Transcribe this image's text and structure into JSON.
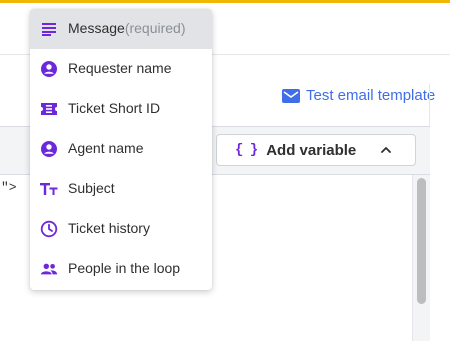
{
  "header": {
    "test_email_label": "Test email template"
  },
  "editor": {
    "code_snippet": "\">",
    "add_variable_label": "Add variable"
  },
  "variable_menu": {
    "items": [
      {
        "label": "Message",
        "hint": "(required)",
        "icon": "text-lines-icon"
      },
      {
        "label": "Requester name",
        "hint": "",
        "icon": "person-circle-icon"
      },
      {
        "label": "Ticket Short ID",
        "hint": "",
        "icon": "ticket-icon"
      },
      {
        "label": "Agent name",
        "hint": "",
        "icon": "person-circle-icon"
      },
      {
        "label": "Subject",
        "hint": "",
        "icon": "text-size-icon"
      },
      {
        "label": "Ticket history",
        "hint": "",
        "icon": "clock-icon"
      },
      {
        "label": "People in the loop",
        "hint": "",
        "icon": "people-icon"
      }
    ]
  },
  "colors": {
    "accent_bar": "#f2b705",
    "link_blue": "#3f6ee8",
    "icon_purple": "#6d28d9",
    "selected_row": "#e1e3e6"
  }
}
